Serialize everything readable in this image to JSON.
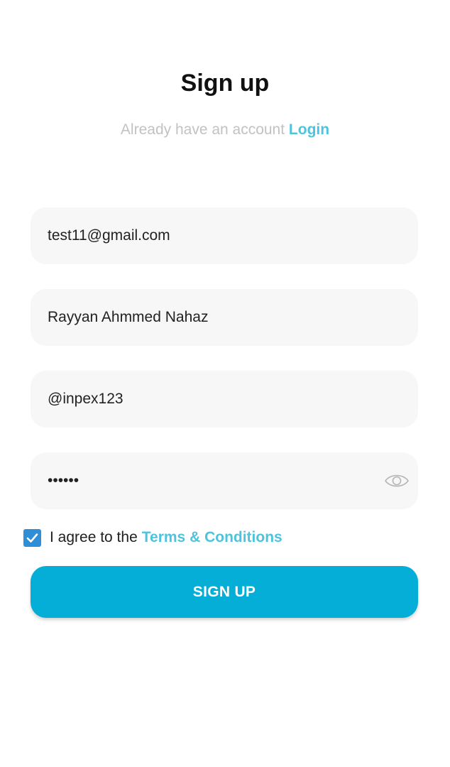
{
  "header": {
    "title": "Sign up",
    "subtitle_text": "Already have an account",
    "login_link": "Login"
  },
  "form": {
    "email": {
      "value": "test11@gmail.com"
    },
    "full_name": {
      "value": "Rayyan Ahmmed Nahaz"
    },
    "username": {
      "value": "@inpex123"
    },
    "password": {
      "value": "••••••",
      "toggle_icon": "eye-icon"
    }
  },
  "agreement": {
    "checked": true,
    "text": "I agree to the",
    "terms_link": "Terms & Conditions"
  },
  "submit": {
    "label": "SIGN UP"
  },
  "colors": {
    "accent": "#4ec3dd",
    "button": "#04aed6",
    "checkbox": "#2f8ed8",
    "field_bg": "#f7f7f7"
  }
}
